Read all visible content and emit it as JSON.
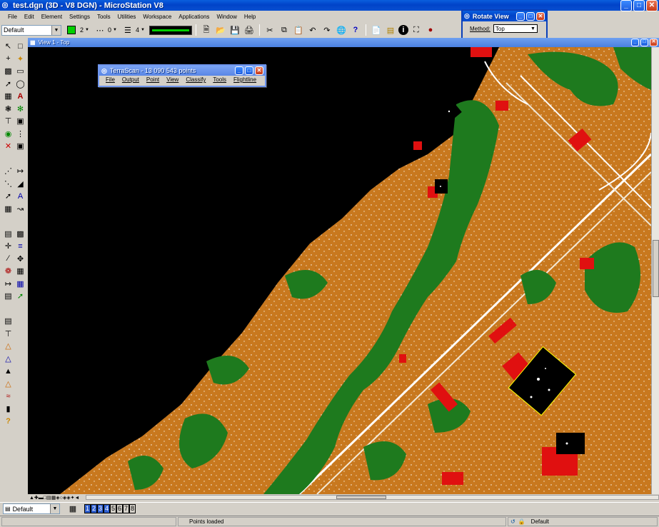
{
  "app_window": {
    "title": "test.dgn (3D - V8 DGN) - MicroStation V8",
    "menu": [
      {
        "label": "File",
        "key": "F"
      },
      {
        "label": "Edit",
        "key": "E"
      },
      {
        "label": "Element",
        "key": "E"
      },
      {
        "label": "Settings",
        "key": "S"
      },
      {
        "label": "Tools",
        "key": "T"
      },
      {
        "label": "Utilities",
        "key": "U"
      },
      {
        "label": "Workspace",
        "key": "k"
      },
      {
        "label": "Applications",
        "key": "A"
      },
      {
        "label": "Window",
        "key": "W"
      },
      {
        "label": "Help",
        "key": "H"
      }
    ]
  },
  "attributes_toolbar": {
    "level": "Default",
    "color_value": "2",
    "linestyle_value": "0",
    "weight_value": "4",
    "active_color": "#00d000"
  },
  "rotate_view": {
    "title": "Rotate View",
    "method_label": "Method:",
    "method_value": "Top"
  },
  "view_window": {
    "title": "View 1 - Top"
  },
  "terrascan": {
    "title": "TerraScan - 13 090 543 points",
    "menu": [
      "File",
      "Output",
      "Point",
      "View",
      "Classify",
      "Tools",
      "Flightline"
    ]
  },
  "bottom_bar": {
    "level": "Default",
    "view_buttons": [
      "1",
      "2",
      "3",
      "4",
      "5",
      "6",
      "7",
      "8"
    ]
  },
  "status_bar": {
    "message": "Points loaded",
    "level": "Default"
  },
  "colors": {
    "ground": "#c8781e",
    "vegetation": "#1e7a1e",
    "buildings": "#e01010",
    "background": "#000000",
    "accent_blue": "#0a4fd0"
  }
}
